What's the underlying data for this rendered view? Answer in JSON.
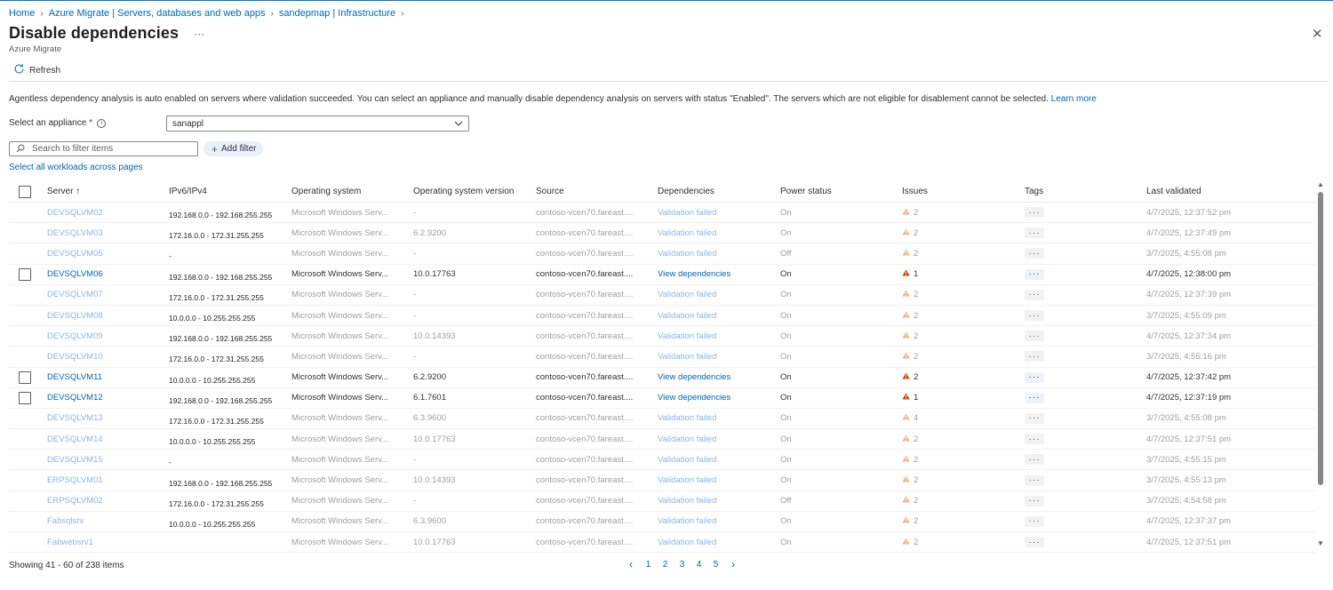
{
  "breadcrumb": [
    "Home",
    "Azure Migrate | Servers, databases and web apps",
    "sandepmap | Infrastructure"
  ],
  "page": {
    "title": "Disable dependencies",
    "subtitle": "Azure Migrate",
    "more_label": "···",
    "close_label": "✕"
  },
  "toolbar": {
    "refresh_label": "Refresh"
  },
  "info": {
    "text": "Agentless dependency analysis is auto enabled on servers where validation succeeded. You can select an appliance and manually disable dependency analysis on servers with status \"Enabled\". The servers which are not eligible for disablement cannot be selected.",
    "link": "Learn more"
  },
  "appliance": {
    "label": "Select an appliance",
    "required_mark": "*",
    "value": "sanappl"
  },
  "filter": {
    "placeholder": "Search to filter items",
    "add_filter_label": "Add filter"
  },
  "select_all_label": "Select all workloads across pages",
  "table": {
    "columns": [
      "Server ↑",
      "IPv6/IPv4",
      "Operating system",
      "Operating system version",
      "Source",
      "Dependencies",
      "Power status",
      "Issues",
      "Tags",
      "Last validated"
    ],
    "tags_label": "···",
    "rows": [
      {
        "server": "DEVSQLVM02",
        "ip": "192.168.0.0 - 192.168.255.255",
        "os": "Microsoft Windows Serv...",
        "version": "-",
        "source": "contoso-vcen70.fareast....",
        "deps": "Validation failed",
        "power": "On",
        "issues": "2",
        "validated": "4/7/2025, 12:37:52 pm",
        "enabled": false
      },
      {
        "server": "DEVSQLVM03",
        "ip": "172.16.0.0 - 172.31.255.255",
        "os": "Microsoft Windows Serv...",
        "version": "6.2.9200",
        "source": "contoso-vcen70.fareast....",
        "deps": "Validation failed",
        "power": "On",
        "issues": "2",
        "validated": "4/7/2025, 12:37:49 pm",
        "enabled": false
      },
      {
        "server": "DEVSQLVM05",
        "ip": "-",
        "os": "Microsoft Windows Serv...",
        "version": "-",
        "source": "contoso-vcen70.fareast....",
        "deps": "Validation failed",
        "power": "Off",
        "issues": "2",
        "validated": "3/7/2025, 4:55:08 pm",
        "enabled": false
      },
      {
        "server": "DEVSQLVM06",
        "ip": "192.168.0.0 - 192.168.255.255",
        "os": "Microsoft Windows Serv...",
        "version": "10.0.17763",
        "source": "contoso-vcen70.fareast....",
        "deps": "View dependencies",
        "power": "On",
        "issues": "1",
        "validated": "4/7/2025, 12:38:00 pm",
        "enabled": true
      },
      {
        "server": "DEVSQLVM07",
        "ip": "172.16.0.0 - 172.31.255.255",
        "os": "Microsoft Windows Serv...",
        "version": "-",
        "source": "contoso-vcen70.fareast....",
        "deps": "Validation failed",
        "power": "On",
        "issues": "2",
        "validated": "4/7/2025, 12:37:39 pm",
        "enabled": false
      },
      {
        "server": "DEVSQLVM08",
        "ip": "10.0.0.0 - 10.255.255.255",
        "os": "Microsoft Windows Serv...",
        "version": "-",
        "source": "contoso-vcen70.fareast....",
        "deps": "Validation failed",
        "power": "On",
        "issues": "2",
        "validated": "3/7/2025, 4:55:09 pm",
        "enabled": false
      },
      {
        "server": "DEVSQLVM09",
        "ip": "192.168.0.0 - 192.168.255.255",
        "os": "Microsoft Windows Serv...",
        "version": "10.0.14393",
        "source": "contoso-vcen70.fareast....",
        "deps": "Validation failed",
        "power": "On",
        "issues": "2",
        "validated": "4/7/2025, 12:37:34 pm",
        "enabled": false
      },
      {
        "server": "DEVSQLVM10",
        "ip": "172.16.0.0 - 172.31.255.255",
        "os": "Microsoft Windows Serv...",
        "version": "-",
        "source": "contoso-vcen70.fareast....",
        "deps": "Validation failed",
        "power": "On",
        "issues": "2",
        "validated": "3/7/2025, 4:55:16 pm",
        "enabled": false
      },
      {
        "server": "DEVSQLVM11",
        "ip": "10.0.0.0 - 10.255.255.255",
        "os": "Microsoft Windows Serv...",
        "version": "6.2.9200",
        "source": "contoso-vcen70.fareast....",
        "deps": "View dependencies",
        "power": "On",
        "issues": "2",
        "validated": "4/7/2025, 12:37:42 pm",
        "enabled": true
      },
      {
        "server": "DEVSQLVM12",
        "ip": "192.168.0.0 - 192.168.255.255",
        "os": "Microsoft Windows Serv...",
        "version": "6.1.7601",
        "source": "contoso-vcen70.fareast....",
        "deps": "View dependencies",
        "power": "On",
        "issues": "1",
        "validated": "4/7/2025, 12:37:19 pm",
        "enabled": true
      },
      {
        "server": "DEVSQLVM13",
        "ip": "172.16.0.0 - 172.31.255.255",
        "os": "Microsoft Windows Serv...",
        "version": "6.3.9600",
        "source": "contoso-vcen70.fareast....",
        "deps": "Validation failed",
        "power": "On",
        "issues": "4",
        "validated": "3/7/2025, 4:55:08 pm",
        "enabled": false
      },
      {
        "server": "DEVSQLVM14",
        "ip": "10.0.0.0 - 10.255.255.255",
        "os": "Microsoft Windows Serv...",
        "version": "10.0.17763",
        "source": "contoso-vcen70.fareast....",
        "deps": "Validation failed",
        "power": "On",
        "issues": "2",
        "validated": "4/7/2025, 12:37:51 pm",
        "enabled": false
      },
      {
        "server": "DEVSQLVM15",
        "ip": "-",
        "os": "Microsoft Windows Serv...",
        "version": "-",
        "source": "contoso-vcen70.fareast....",
        "deps": "Validation failed",
        "power": "On",
        "issues": "2",
        "validated": "3/7/2025, 4:55:15 pm",
        "enabled": false
      },
      {
        "server": "ERPSQLVM01",
        "ip": "192.168.0.0 - 192.168.255.255",
        "os": "Microsoft Windows Serv...",
        "version": "10.0.14393",
        "source": "contoso-vcen70.fareast....",
        "deps": "Validation failed",
        "power": "On",
        "issues": "2",
        "validated": "3/7/2025, 4:55:13 pm",
        "enabled": false
      },
      {
        "server": "ERPSQLVM02",
        "ip": "172.16.0.0 - 172.31.255.255",
        "os": "Microsoft Windows Serv...",
        "version": "-",
        "source": "contoso-vcen70.fareast....",
        "deps": "Validation failed",
        "power": "Off",
        "issues": "2",
        "validated": "3/7/2025, 4:54:58 pm",
        "enabled": false
      },
      {
        "server": "Fabsqlsrv",
        "ip": "10.0.0.0 - 10.255.255.255",
        "os": "Microsoft Windows Serv...",
        "version": "6.3.9600",
        "source": "contoso-vcen70.fareast....",
        "deps": "Validation failed",
        "power": "On",
        "issues": "2",
        "validated": "4/7/2025, 12:37:37 pm",
        "enabled": false
      },
      {
        "server": "Fabwebsrv1",
        "ip": "",
        "os": "Microsoft Windows Serv...",
        "version": "10.0.17763",
        "source": "contoso-vcen70.fareast....",
        "deps": "Validation failed",
        "power": "On",
        "issues": "2",
        "validated": "4/7/2025, 12:37:51 pm",
        "enabled": false
      }
    ]
  },
  "footer": {
    "showing": "Showing 41 - 60 of 238 items"
  },
  "pagination": {
    "pages": [
      "1",
      "2",
      "3",
      "4",
      "5"
    ],
    "prev": "‹",
    "next": "›"
  },
  "colors": {
    "accent": "#0078d4",
    "link": "#0067b8",
    "warning": "#d83b01",
    "warning_disabled": "#f2b183"
  }
}
